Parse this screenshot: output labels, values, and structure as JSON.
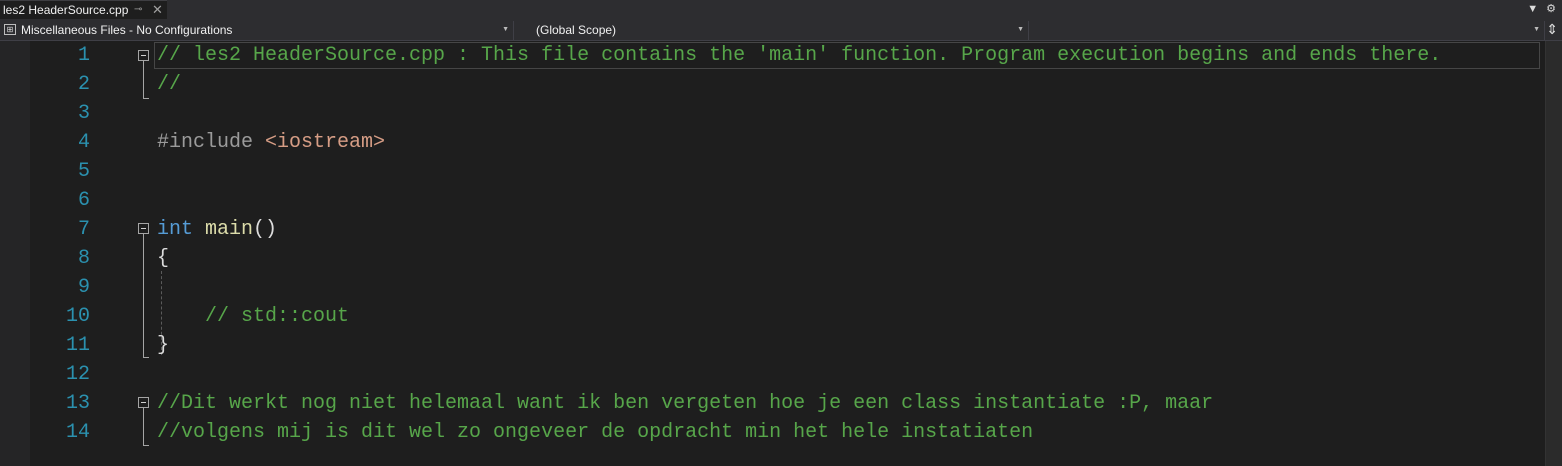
{
  "tab": {
    "title": "les2 HeaderSource.cpp",
    "pin_icon": "pin-icon",
    "close_icon": "close-icon"
  },
  "toolbar_right": {
    "dropdown_icon": "chevron-down-icon",
    "settings_icon": "gear-icon"
  },
  "nav": {
    "project": "Miscellaneous Files - No Configurations",
    "scope": "(Global Scope)",
    "member": "",
    "split_icon": "split-icon"
  },
  "editor": {
    "line_numbers": [
      "1",
      "2",
      "3",
      "4",
      "5",
      "6",
      "7",
      "8",
      "9",
      "10",
      "11",
      "12",
      "13",
      "14"
    ],
    "lines": [
      "// les2 HeaderSource.cpp : This file contains the 'main' function. Program execution begins and ends there.",
      "//",
      "",
      "#include <iostream>",
      "",
      "",
      "int main()",
      "{",
      "",
      "    // std::cout",
      "}",
      "",
      "//Dit werkt nog niet helemaal want ik ben vergeten hoe je een class instantiate :P, maar",
      "//volgens mij is dit wel zo ongeveer de opdracht min het hele instatiaten"
    ],
    "tokens": {
      "include_directive": "#include",
      "include_header": "<iostream>",
      "kw_int": "int",
      "fn_main": "main",
      "parens": "()"
    },
    "colors": {
      "comment": "#57a64a",
      "keyword": "#569cd6",
      "function": "#dcdcaa",
      "string": "#d69d85",
      "line_number": "#2b91af",
      "background": "#1e1e1e"
    }
  }
}
